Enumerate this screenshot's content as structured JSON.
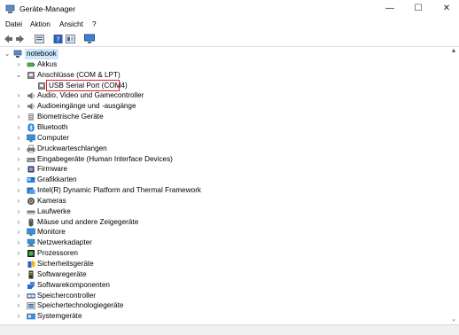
{
  "window": {
    "title": "Geräte-Manager",
    "minimize": "—",
    "maximize": "☐",
    "close": "✕"
  },
  "menu": {
    "items": [
      "Datei",
      "Aktion",
      "Ansicht",
      "?"
    ]
  },
  "tree": {
    "root": "notebook",
    "items": [
      {
        "label": "Akkus",
        "expanded": false,
        "icon": "battery-icon"
      },
      {
        "label": "Anschlüsse (COM & LPT)",
        "expanded": true,
        "icon": "port-icon"
      },
      {
        "label": "USB Serial Port (COM4)",
        "child": true,
        "selected": true,
        "icon": "port-icon"
      },
      {
        "label": "Audio, Video und Gamecontroller",
        "icon": "speaker-icon"
      },
      {
        "label": "Audioeingänge und -ausgänge",
        "icon": "speaker-icon"
      },
      {
        "label": "Biometrische Geräte",
        "icon": "fingerprint-icon"
      },
      {
        "label": "Bluetooth",
        "icon": "bluetooth-icon"
      },
      {
        "label": "Computer",
        "icon": "monitor-icon"
      },
      {
        "label": "Druckwarteschlangen",
        "icon": "printer-icon"
      },
      {
        "label": "Eingabegeräte (Human Interface Devices)",
        "icon": "hid-icon"
      },
      {
        "label": "Firmware",
        "icon": "chip-icon"
      },
      {
        "label": "Grafikkarten",
        "icon": "display-adapter-icon"
      },
      {
        "label": "Intel(R) Dynamic Platform and Thermal Framework",
        "icon": "folder-icon"
      },
      {
        "label": "Kameras",
        "icon": "camera-icon"
      },
      {
        "label": "Laufwerke",
        "icon": "drive-icon"
      },
      {
        "label": "Mäuse und andere Zeigegeräte",
        "icon": "mouse-icon"
      },
      {
        "label": "Monitore",
        "icon": "monitor-icon"
      },
      {
        "label": "Netzwerkadapter",
        "icon": "network-icon"
      },
      {
        "label": "Prozessoren",
        "icon": "cpu-icon"
      },
      {
        "label": "Sicherheitsgeräte",
        "icon": "security-icon"
      },
      {
        "label": "Softwaregeräte",
        "icon": "software-device-icon"
      },
      {
        "label": "Softwarekomponenten",
        "icon": "puzzle-icon"
      },
      {
        "label": "Speichercontroller",
        "icon": "storage-controller-icon"
      },
      {
        "label": "Speichertechnologiegeräte",
        "icon": "storage-icon"
      },
      {
        "label": "Systemgeräte",
        "icon": "system-icon"
      }
    ]
  }
}
